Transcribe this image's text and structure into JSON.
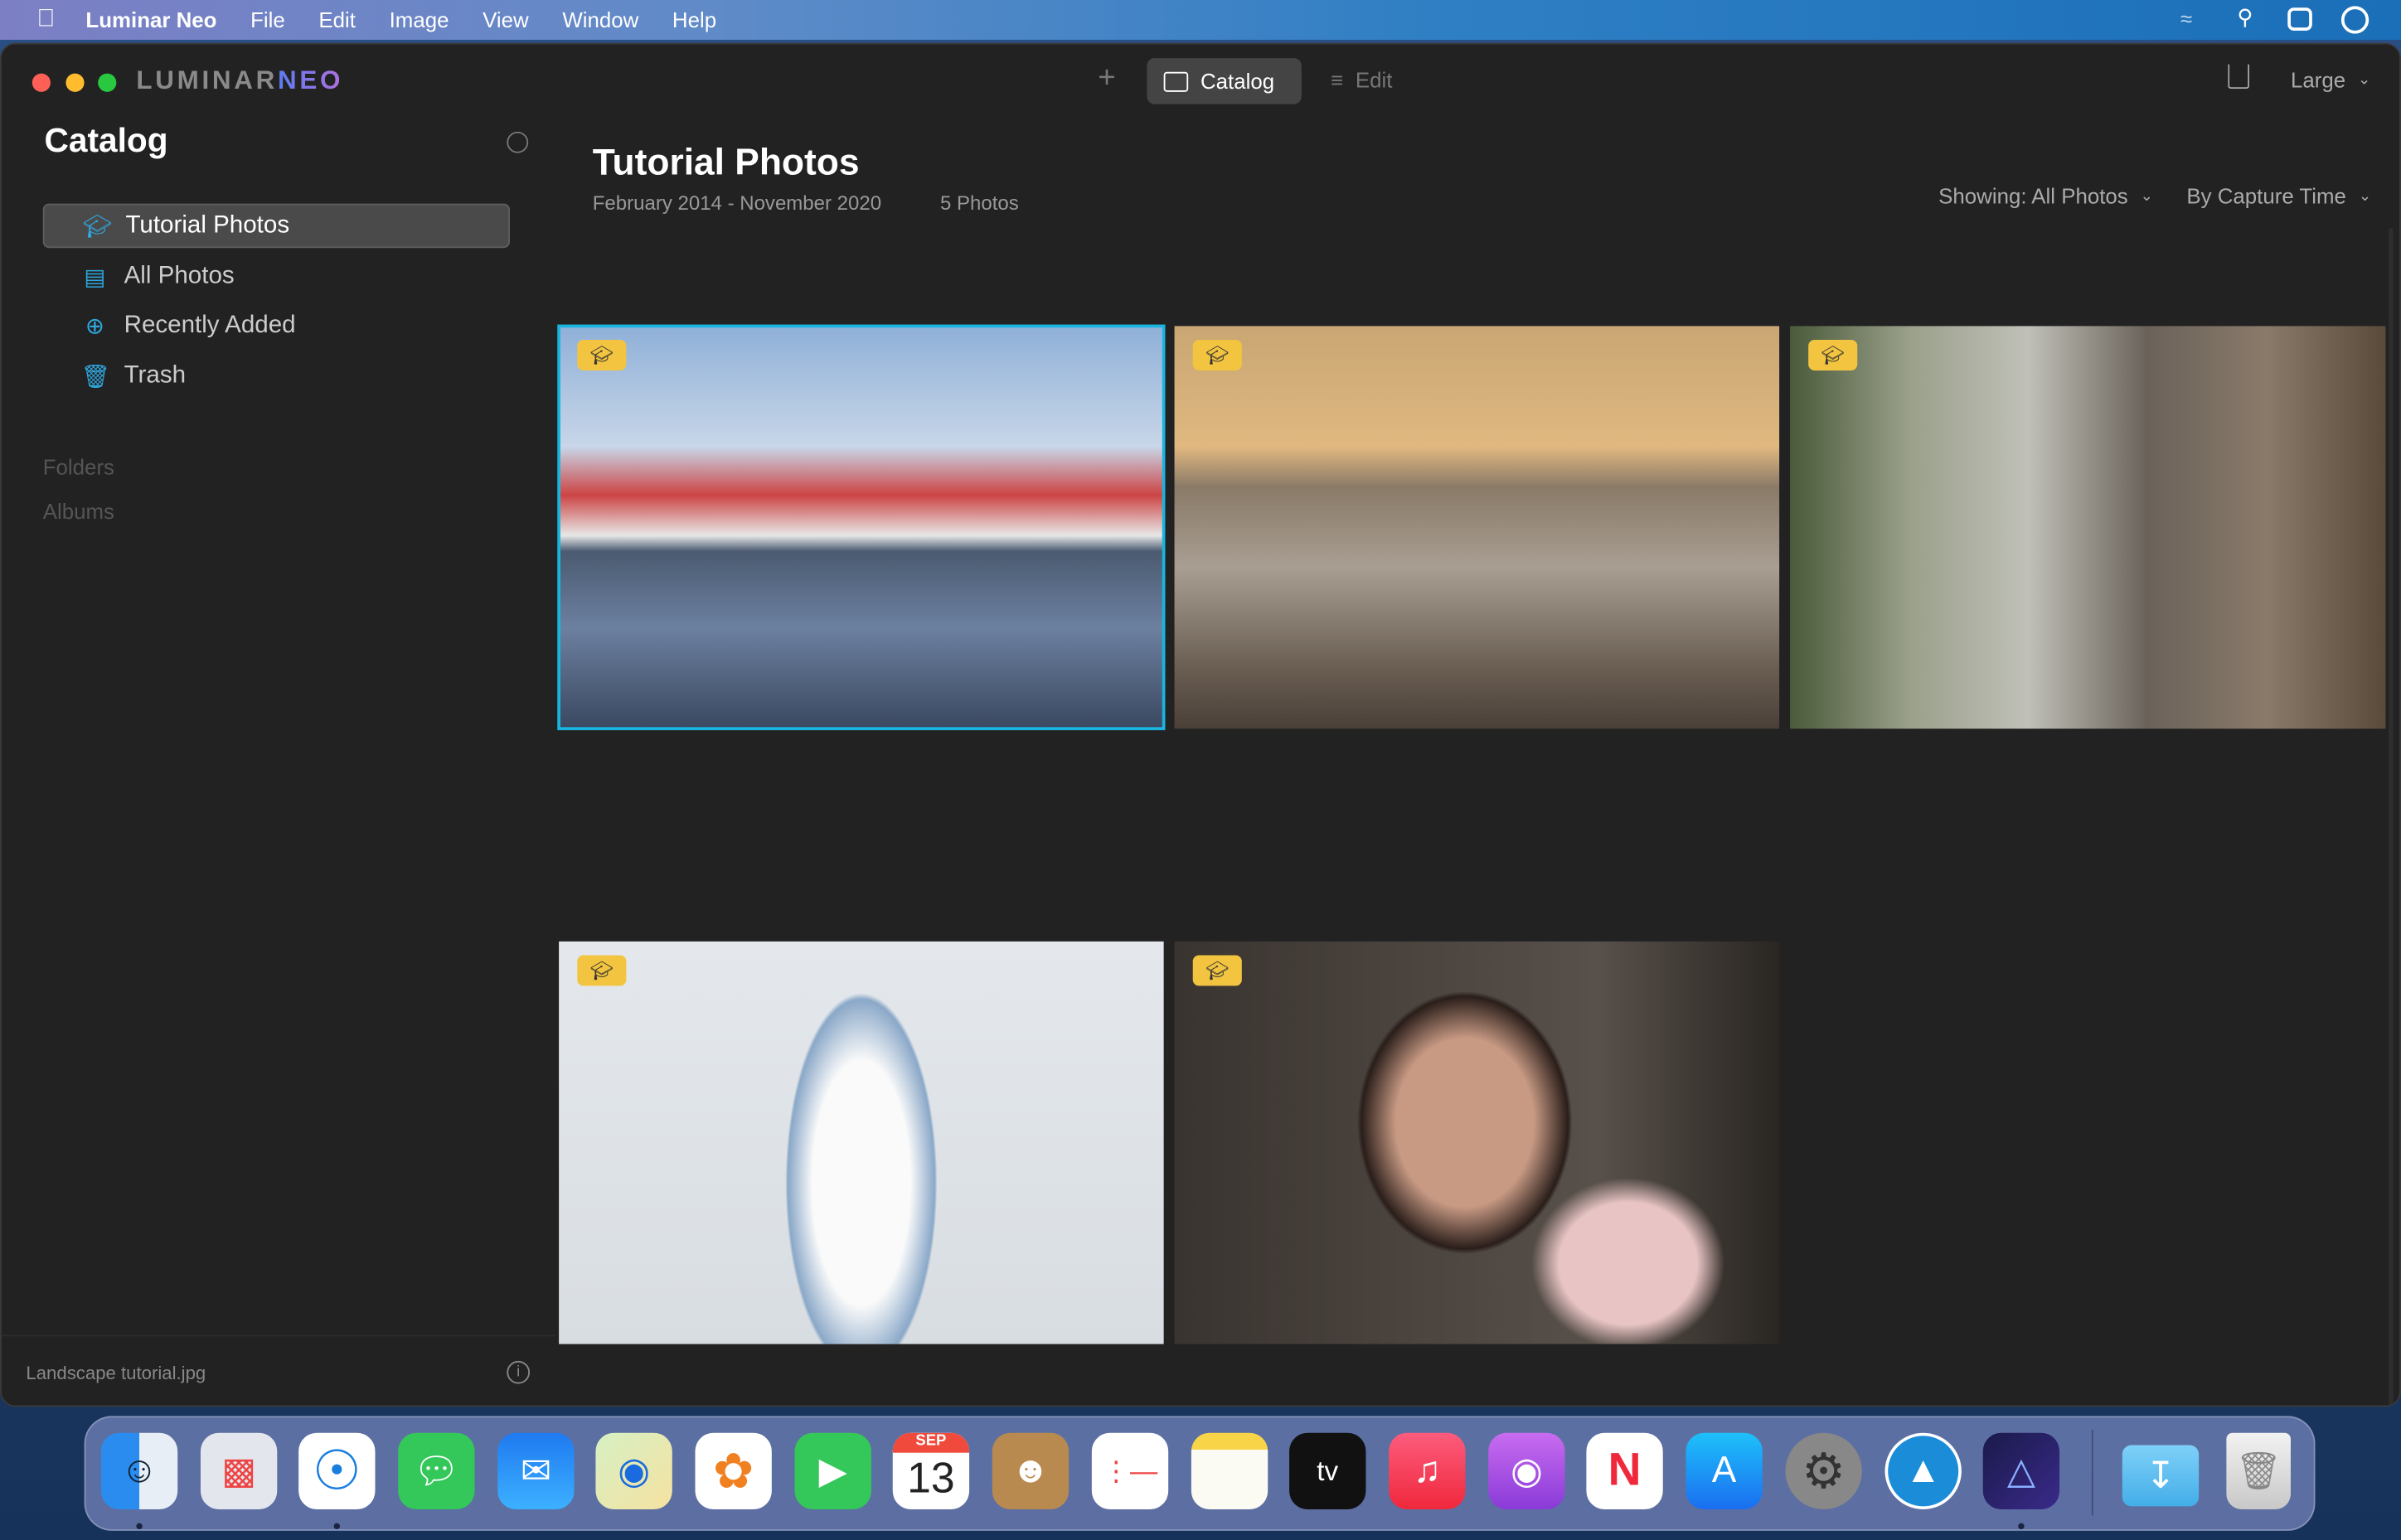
{
  "menubar": {
    "app": "Luminar Neo",
    "items": [
      "File",
      "Edit",
      "Image",
      "View",
      "Window",
      "Help"
    ],
    "icons": [
      "apple-icon",
      "wifi-icon",
      "spotlight-search-icon",
      "control-center-icon",
      "clock-icon"
    ]
  },
  "toolbar": {
    "logo": "LUMINAR",
    "logo_accent": "NEO",
    "tabs": [
      {
        "label": "Catalog",
        "active": true
      },
      {
        "label": "Edit",
        "active": false
      }
    ],
    "size": "Large"
  },
  "sidebar": {
    "title": "Catalog",
    "items": [
      {
        "label": "Tutorial Photos",
        "icon": "graduation-cap-icon",
        "selected": true
      },
      {
        "label": "All Photos",
        "icon": "photo-stack-icon"
      },
      {
        "label": "Recently Added",
        "icon": "plus-circle-icon"
      },
      {
        "label": "Trash",
        "icon": "trash-icon"
      }
    ],
    "sections": [
      "Folders",
      "Albums"
    ],
    "footer_file": "Landscape tutorial.jpg"
  },
  "main": {
    "title": "Tutorial Photos",
    "date_range": "February 2014 - November 2020",
    "count": "5 Photos",
    "filter": "Showing: All Photos",
    "sort": "By Capture Time"
  },
  "photos": [
    {
      "subject": "colorful harbor houses reflection",
      "selected": true
    },
    {
      "subject": "beach at sunset"
    },
    {
      "subject": "city street with taxis"
    },
    {
      "subject": "woman in white blouse and jeans"
    },
    {
      "subject": "woman portrait with pink ruffle"
    }
  ],
  "dock": {
    "calendar_month": "SEP",
    "calendar_day": "13",
    "apps": [
      "finder",
      "launchpad",
      "safari",
      "messages",
      "mail",
      "maps",
      "photos",
      "facetime",
      "calendar",
      "contacts",
      "reminders",
      "notes",
      "apple-tv",
      "music",
      "podcasts",
      "news",
      "app-store",
      "system-preferences",
      "luminar-share",
      "luminar-neo",
      "downloads",
      "trash"
    ]
  },
  "colors": {
    "accent": "#1ab4e0",
    "badge": "#f2c440"
  }
}
